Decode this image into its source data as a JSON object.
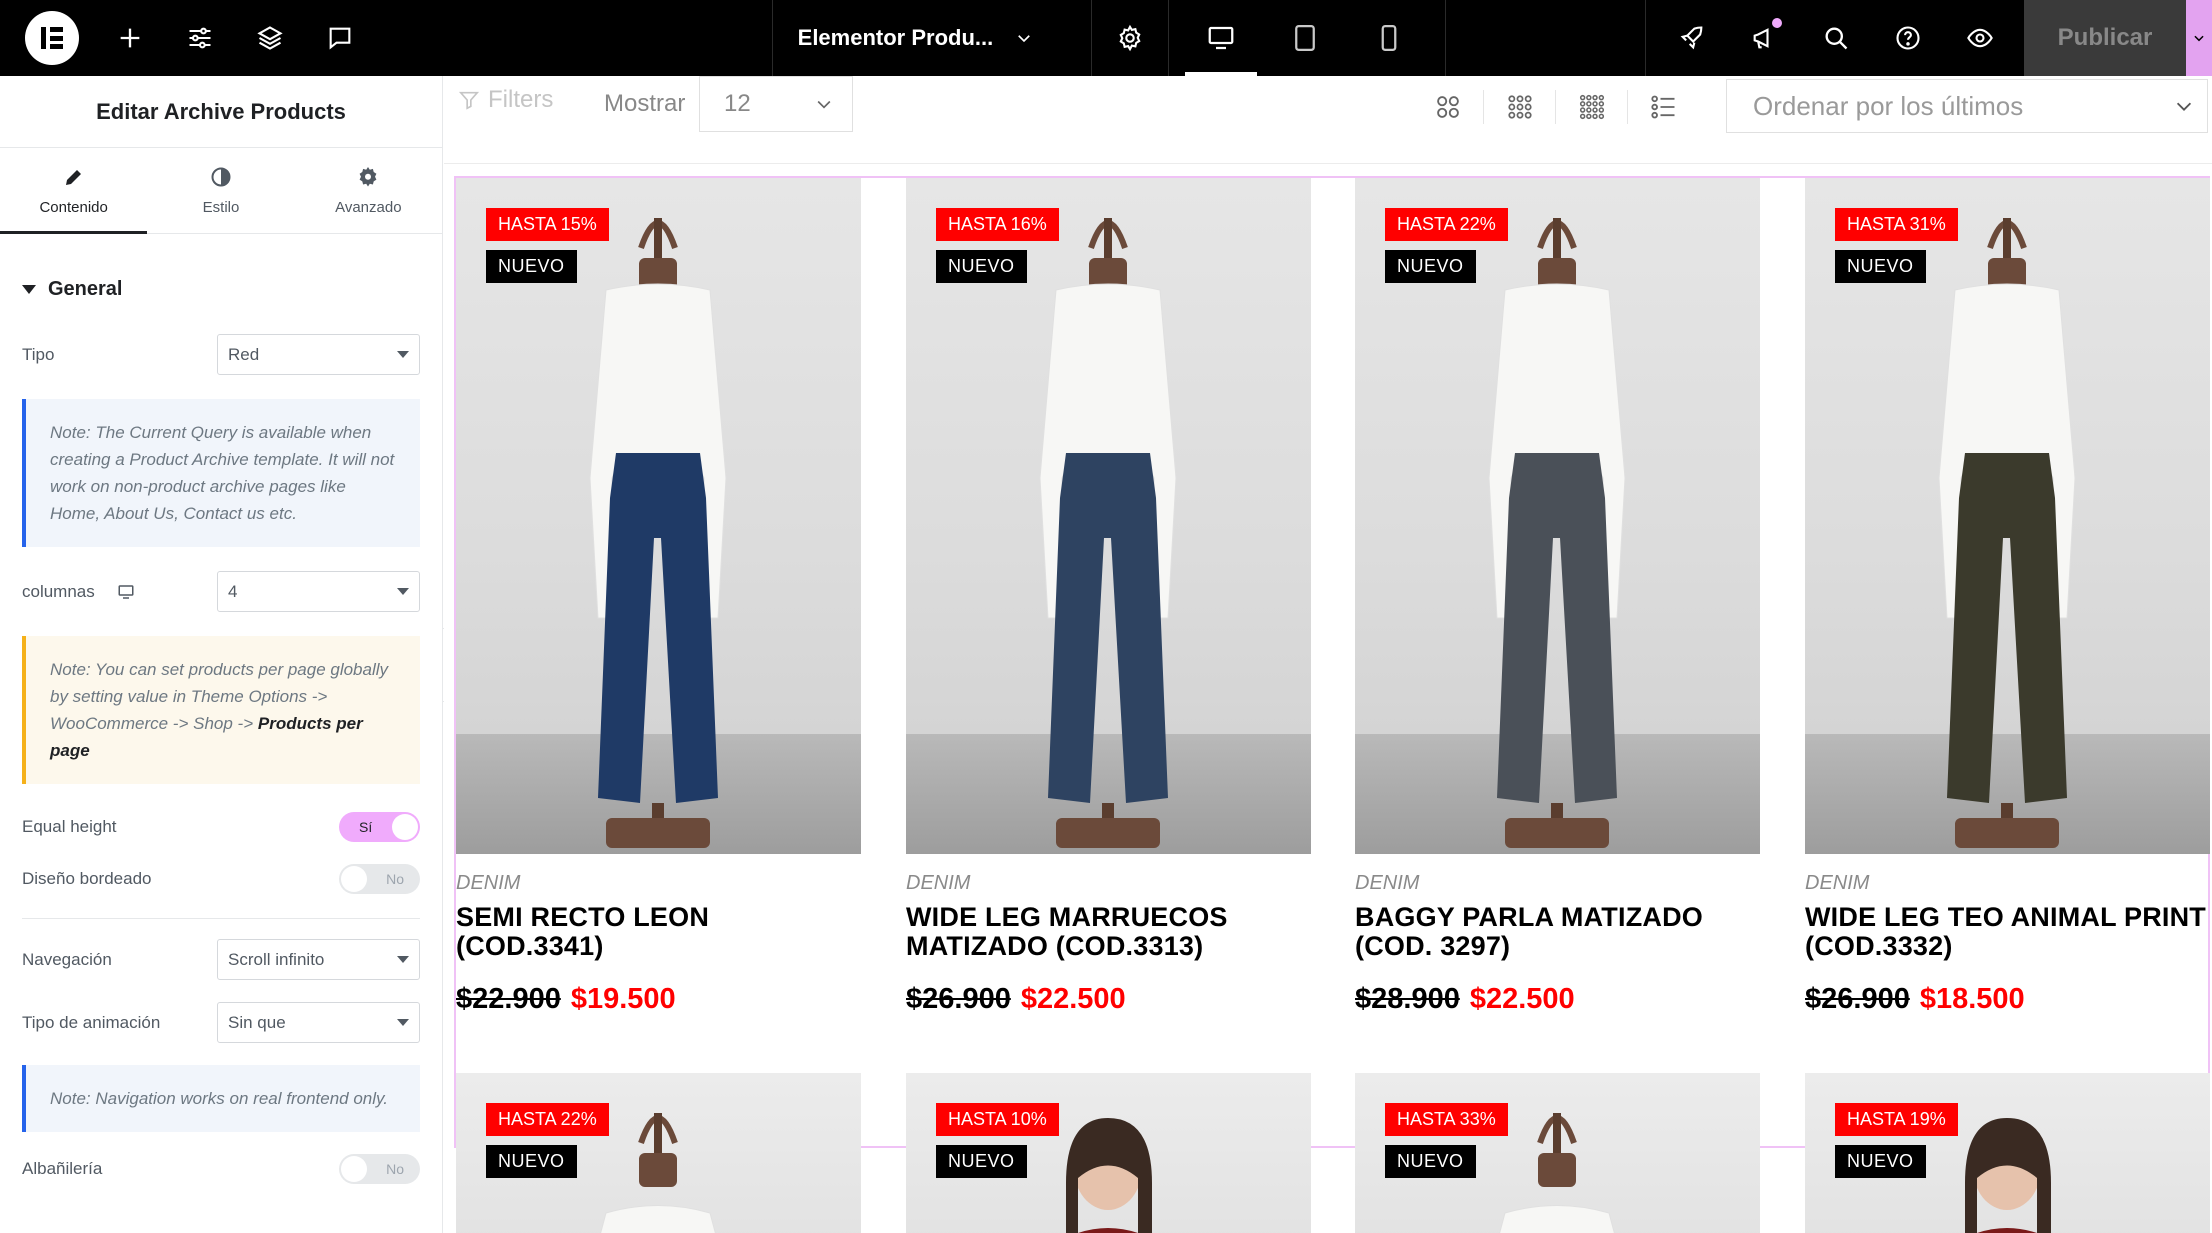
{
  "topbar": {
    "document_title": "Elementor Produ...",
    "publish_label": "Publicar"
  },
  "sidebar": {
    "title": "Editar Archive Products",
    "tabs": [
      {
        "label": "Contenido",
        "icon": "pencil-icon",
        "active": true
      },
      {
        "label": "Estilo",
        "icon": "half-circle-icon",
        "active": false
      },
      {
        "label": "Avanzado",
        "icon": "gear-icon",
        "active": false
      }
    ],
    "section_title": "General",
    "tipo": {
      "label": "Tipo",
      "value": "Red"
    },
    "note_query": "Note: The Current Query is available when creating a Product Archive template. It will not work on non-product archive pages like Home, About Us, Contact us etc.",
    "columnas": {
      "label": "columnas",
      "value": "4"
    },
    "note_per_page_pre": "Note: You can set products per page globally by setting value in Theme Options -> WooCommerce -> Shop -> ",
    "note_per_page_bold": "Products per page",
    "equal_height": {
      "label": "Equal height",
      "value": "Sí"
    },
    "bordered": {
      "label": "Diseño bordeado",
      "value": "No"
    },
    "navegacion": {
      "label": "Navegación",
      "value": "Scroll infinito"
    },
    "animacion": {
      "label": "Tipo de animación",
      "value": "Sin que"
    },
    "note_navigation": "Note: Navigation works on real frontend only.",
    "masonry": {
      "label": "Albañilería",
      "value": "No"
    }
  },
  "shop": {
    "filters_label": "Filters",
    "show_label": "Mostrar",
    "per_page": "12",
    "orderby": "Ordenar por los últimos"
  },
  "products": [
    {
      "sale": "HASTA 15%",
      "new": "NUEVO",
      "category": "DENIM",
      "name": "SEMI RECTO LEON (COD.3341)",
      "old_price": "$22.900",
      "price": "$19.500",
      "jean": "#1f3a66"
    },
    {
      "sale": "HASTA 16%",
      "new": "NUEVO",
      "category": "DENIM",
      "name": "WIDE LEG MARRUECOS MATIZADO (COD.3313)",
      "old_price": "$26.900",
      "price": "$22.500",
      "jean": "#2e4361"
    },
    {
      "sale": "HASTA 22%",
      "new": "NUEVO",
      "category": "DENIM",
      "name": "BAGGY PARLA MATIZADO (COD. 3297)",
      "old_price": "$28.900",
      "price": "$22.500",
      "jean": "#4a5058"
    },
    {
      "sale": "HASTA 31%",
      "new": "NUEVO",
      "category": "DENIM",
      "name": "WIDE LEG TEO ANIMAL PRINT (COD.3332)",
      "old_price": "$26.900",
      "price": "$18.500",
      "jean": "#3b3a2c"
    }
  ],
  "products_row2": [
    {
      "sale": "HASTA 22%",
      "new": "NUEVO"
    },
    {
      "sale": "HASTA 10%",
      "new": "NUEVO"
    },
    {
      "sale": "HASTA 33%",
      "new": "NUEVO"
    },
    {
      "sale": "HASTA 19%",
      "new": "NUEVO"
    }
  ]
}
